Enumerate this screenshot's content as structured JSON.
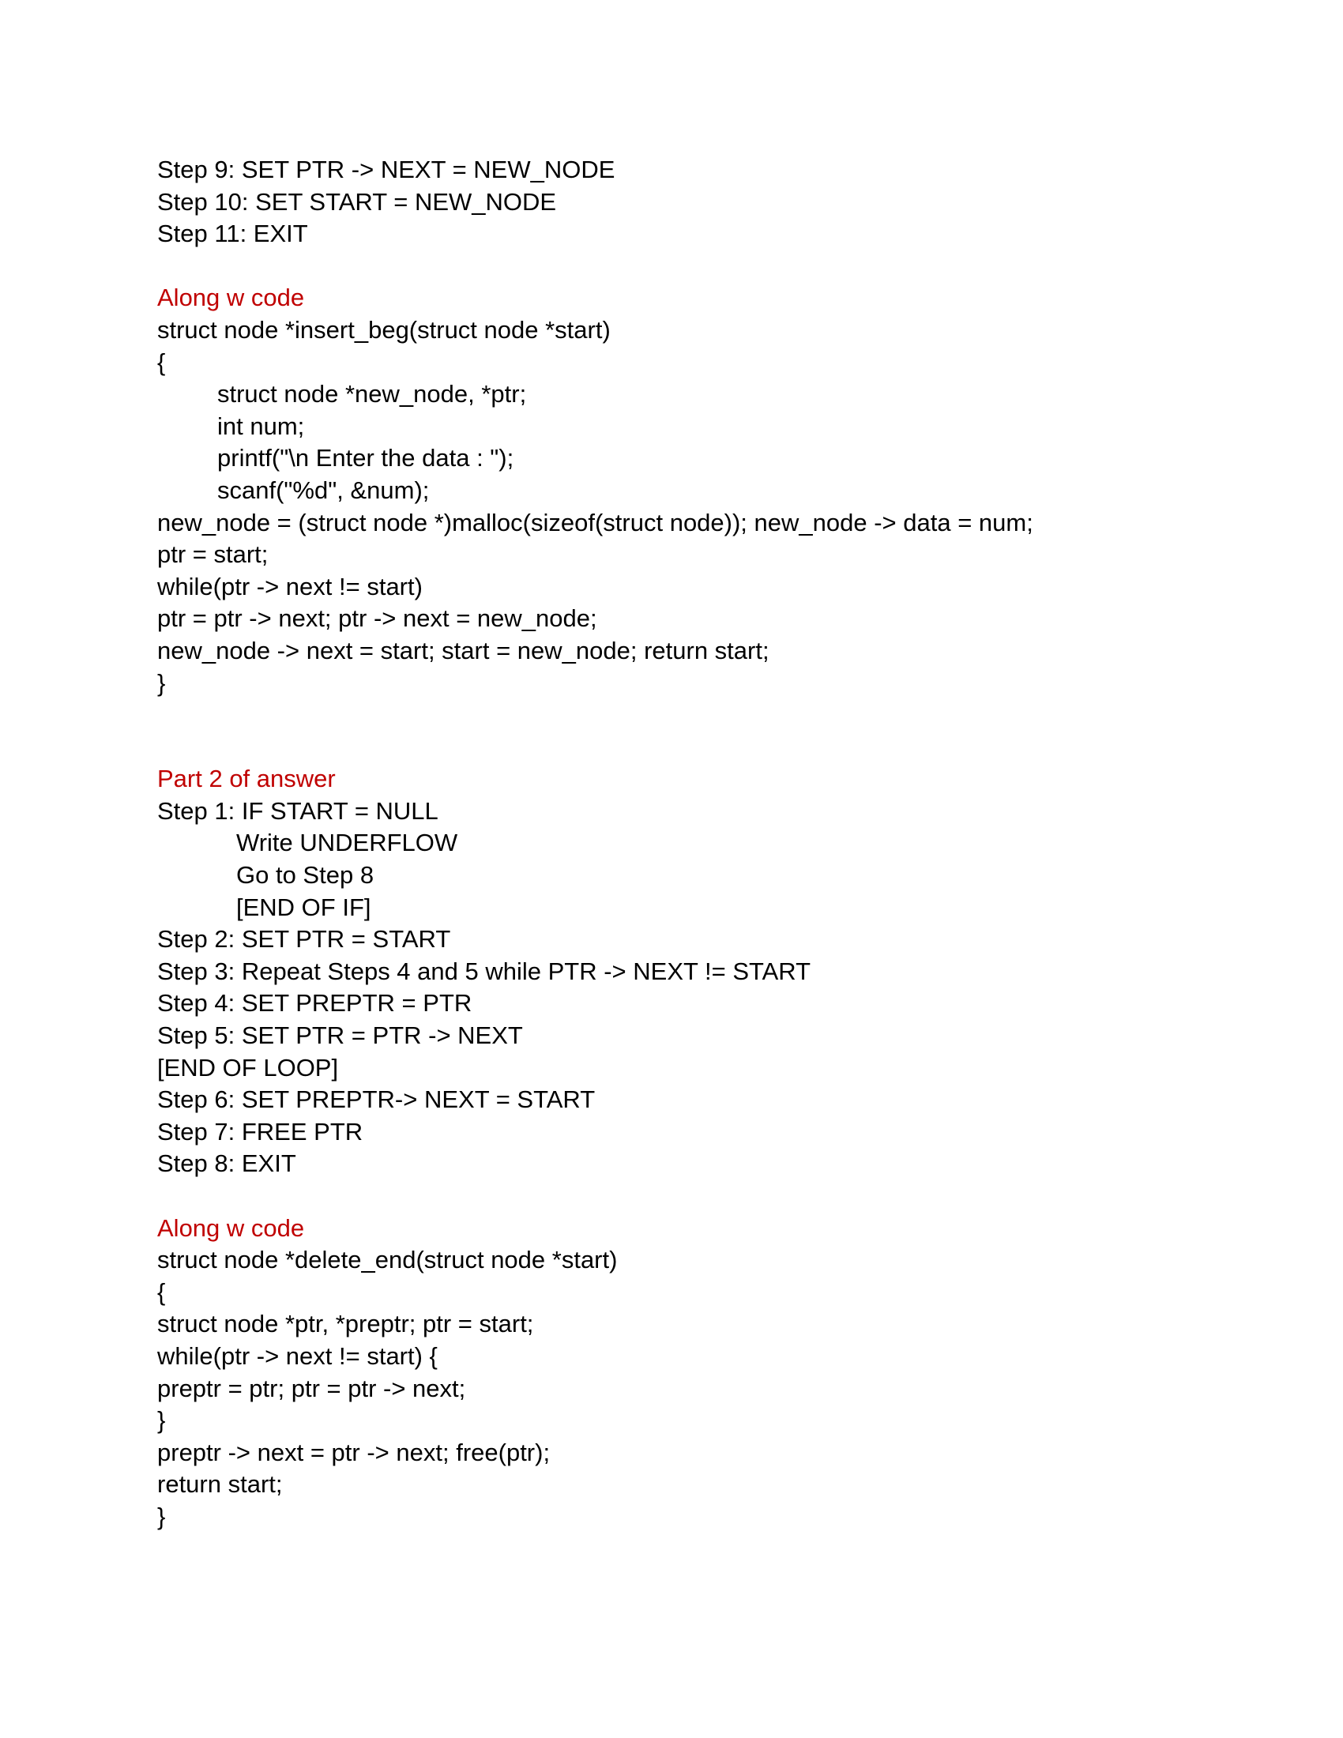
{
  "section1_steps": [
    "Step 9: SET PTR -> NEXT = NEW_NODE",
    "Step 10: SET START = NEW_NODE",
    "Step 11: EXIT"
  ],
  "heading_code_1": "Along w code",
  "code1": {
    "signature": "struct node *insert_beg(struct node *start)",
    "open_brace": "{",
    "indented": [
      "struct node *new_node, *ptr;",
      "int num;",
      "printf(\"\\n Enter the data : \");",
      "scanf(\"%d\", &num);"
    ],
    "body": [
      "new_node = (struct node *)malloc(sizeof(struct node)); new_node -> data = num;",
      "ptr = start;",
      "while(ptr -> next != start)",
      "ptr = ptr -> next; ptr -> next = new_node;",
      "new_node -> next = start; start = new_node; return start;"
    ],
    "close_brace": "}"
  },
  "heading_part2": "Part 2 of answer",
  "part2": {
    "step1": "Step 1: IF START = NULL",
    "step1_indented": [
      "Write UNDERFLOW",
      "Go to Step 8",
      "[END OF IF]"
    ],
    "steps": [
      "Step 2: SET PTR = START",
      "Step 3: Repeat Steps 4 and 5 while PTR -> NEXT != START",
      "Step 4: SET PREPTR = PTR",
      "Step 5: SET PTR = PTR -> NEXT",
      "[END OF LOOP]",
      "Step 6: SET PREPTR-> NEXT = START",
      "Step 7: FREE PTR",
      "Step 8: EXIT"
    ]
  },
  "heading_code_2": "Along w code",
  "code2": {
    "lines": [
      "struct node *delete_end(struct node *start)",
      "{",
      "struct node *ptr, *preptr; ptr = start;",
      "while(ptr -> next != start) {",
      "preptr = ptr; ptr = ptr -> next;",
      "}",
      "preptr -> next = ptr -> next; free(ptr);",
      "return start;",
      "}"
    ]
  }
}
